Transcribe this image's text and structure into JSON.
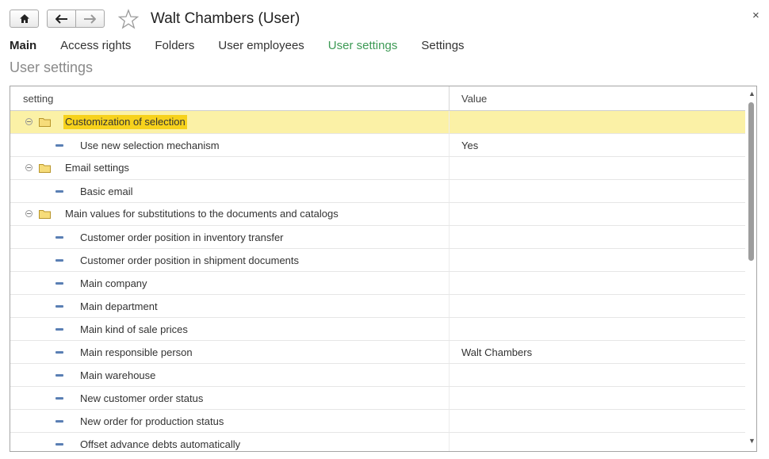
{
  "window": {
    "title": "Walt Chambers (User)",
    "close_glyph": "×"
  },
  "toolbar": {
    "home_icon": "home-icon",
    "back_icon": "arrow-left-icon",
    "forward_icon": "arrow-right-icon",
    "favorite_icon": "star-icon"
  },
  "tabs": [
    {
      "label": "Main"
    },
    {
      "label": "Access rights"
    },
    {
      "label": "Folders"
    },
    {
      "label": "User employees"
    },
    {
      "label": "User settings"
    },
    {
      "label": "Settings"
    }
  ],
  "page": {
    "heading": "User settings"
  },
  "table": {
    "columns": [
      "setting",
      "Value"
    ],
    "rows": [
      {
        "type": "group",
        "label": "Customization of selection",
        "value": "",
        "selected": true
      },
      {
        "type": "item",
        "label": "Use new selection mechanism",
        "value": "Yes"
      },
      {
        "type": "group",
        "label": "Email settings",
        "value": ""
      },
      {
        "type": "item",
        "label": "Basic email",
        "value": ""
      },
      {
        "type": "group",
        "label": "Main values for substitutions to the documents and catalogs",
        "value": ""
      },
      {
        "type": "item",
        "label": "Customer order position in inventory transfer",
        "value": ""
      },
      {
        "type": "item",
        "label": "Customer order position in shipment documents",
        "value": ""
      },
      {
        "type": "item",
        "label": "Main company",
        "value": ""
      },
      {
        "type": "item",
        "label": "Main department",
        "value": ""
      },
      {
        "type": "item",
        "label": "Main kind of sale prices",
        "value": ""
      },
      {
        "type": "item",
        "label": "Main responsible person",
        "value": "Walt Chambers"
      },
      {
        "type": "item",
        "label": "Main warehouse",
        "value": ""
      },
      {
        "type": "item",
        "label": "New customer order status",
        "value": ""
      },
      {
        "type": "item",
        "label": "New order for production status",
        "value": ""
      },
      {
        "type": "item",
        "label": "Offset advance debts automatically",
        "value": ""
      }
    ]
  },
  "colors": {
    "active_tab": "#3d9a55",
    "selected_row": "#fbf1a6",
    "highlight": "#f7d21c"
  }
}
